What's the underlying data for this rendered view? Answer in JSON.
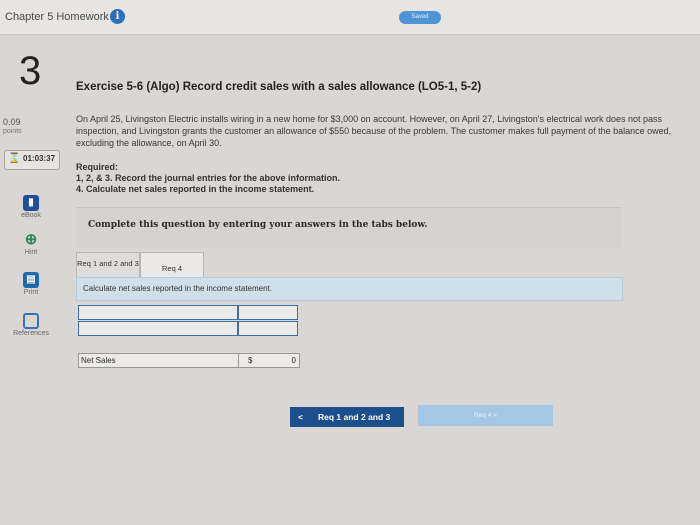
{
  "header": {
    "chapter_title": "Chapter 5 Homework",
    "info_icon": "i",
    "saved_label": "Saved"
  },
  "sidebar": {
    "question_number": "3",
    "points_value": "0.09",
    "points_label": "points",
    "timer": "01:03:37",
    "tools": [
      {
        "label": "eBook"
      },
      {
        "label": "Hint"
      },
      {
        "label": "Print"
      },
      {
        "label": "References"
      }
    ]
  },
  "exercise": {
    "title": "Exercise 5-6 (Algo) Record credit sales with a sales allowance (LO5-1, 5-2)",
    "paragraph": "On April 25, Livingston Electric installs wiring in a new home for $3,000 on account. However, on April 27, Livingston's electrical work does not pass inspection, and Livingston grants the customer an allowance of $550 because of the problem. The customer makes full payment of the balance owed, excluding the allowance, on April 30.",
    "required_label": "Required:",
    "required_1": "1, 2, & 3. Record the journal entries for the above information.",
    "required_2": "4. Calculate net sales reported in the income statement."
  },
  "panel": {
    "complete_text": "Complete this question by entering your answers in the tabs below.",
    "tabs": [
      {
        "label": "Req 1 and 2 and 3"
      },
      {
        "label": "Req 4"
      }
    ],
    "instruction": "Calculate net sales reported in the income statement.",
    "net_sales_label": "Net Sales",
    "currency": "$",
    "net_sales_value": "0"
  },
  "nav": {
    "prev_label": "Req 1 and 2 and 3",
    "prev_chevron": "<",
    "next_label": "Req 4  >"
  }
}
